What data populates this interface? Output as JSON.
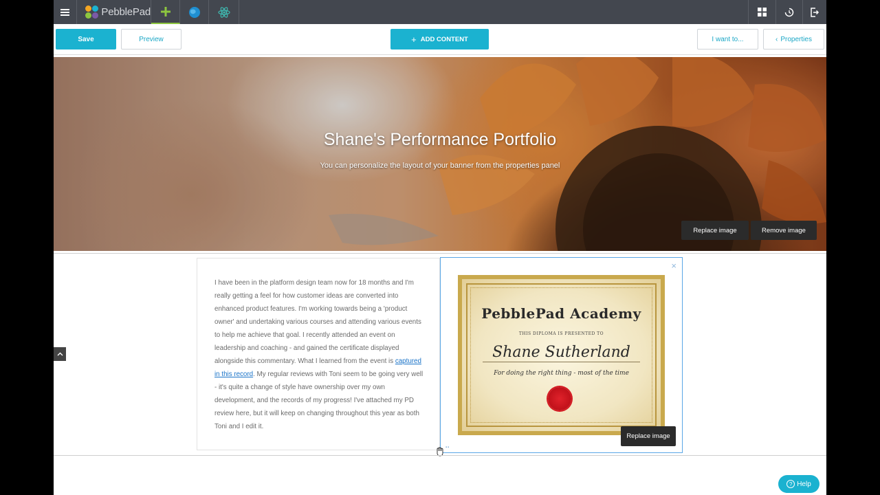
{
  "topbar": {
    "logo_text": "PebblePad",
    "icons": [
      "hamburger-icon",
      "pebblepad-logo",
      "create-icon",
      "globe-icon",
      "atom-icon",
      "grid-icon",
      "history-icon",
      "exit-icon"
    ]
  },
  "toolbar": {
    "save_label": "Save",
    "preview_label": "Preview",
    "add_content_label": "ADD CONTENT",
    "i_want_label": "I want to...",
    "properties_label": "Properties"
  },
  "banner": {
    "title": "Shane's Performance Portfolio",
    "subtitle": "You can personalize the layout of your banner from the properties panel",
    "replace_label": "Replace image",
    "remove_label": "Remove image"
  },
  "content": {
    "text_before_link": "I have been in the platform design team now for 18 months and I'm really getting a feel for how customer ideas are converted into enhanced product features. I'm working towards being a 'product owner' and undertaking various courses and attending various events to help me achieve that goal. I recently attended an event on leadership and coaching - and gained the certificate displayed alongside this commentary. What I learned from the event is ",
    "link_text": "captured in this record",
    "text_after_link": ". My regular reviews with Toni seem to be going very well - it's quite a change of style have ownership over my own development, and the records of my progress! I've attached my PD review here, but it will keep on changing throughout this year as both Toni and I edit it."
  },
  "certificate": {
    "academy": "PebblePad Academy",
    "presented": "THIS DIPLOMA IS PRESENTED TO",
    "name": "Shane Sutherland",
    "motto": "For doing the right thing - most of the time"
  },
  "image_block": {
    "replace_label": "Replace image"
  },
  "help": {
    "label": "Help"
  },
  "colors": {
    "accent": "#1bb2d0",
    "topbar": "#43474f",
    "selection_border": "#58a6e6",
    "create_tab_underline": "#8dc63f"
  }
}
